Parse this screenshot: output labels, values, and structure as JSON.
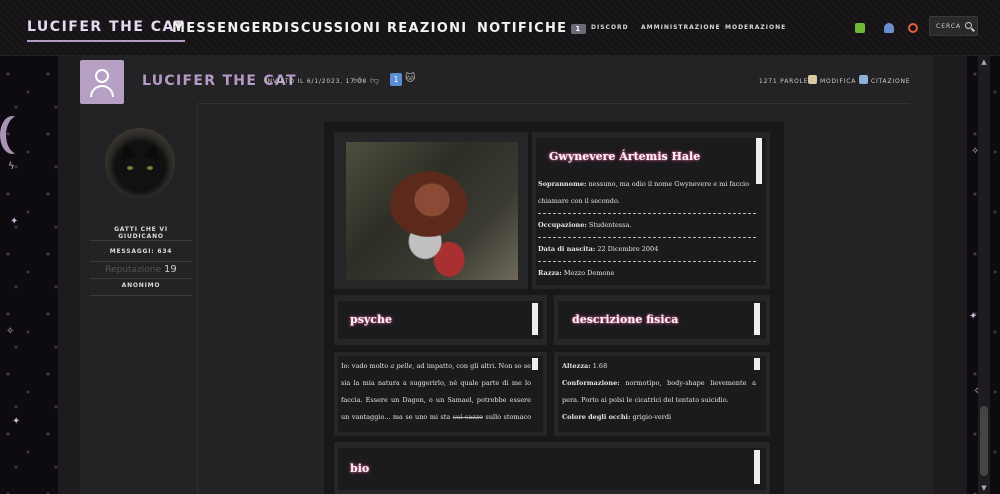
{
  "nav": {
    "brand": "LUCIFER THE CAT",
    "links": [
      "MESSENGER",
      "DISCUSSIONI",
      "REAZIONI",
      "NOTIFICHE"
    ],
    "notif_count": "1",
    "small_links": [
      "DISCORD",
      "AMMINISTRAZIONE",
      "MODERAZIONE"
    ],
    "search_placeholder": "CERCA"
  },
  "post": {
    "username": "LUCIFER THE CAT",
    "meta": "INVIATO IL 6/1/2023, 17:08",
    "reaction_count": "1",
    "word_count": "1271 PAROLE",
    "edit_label": "MODIFICA",
    "quote_label": "CITAZIONE"
  },
  "user": {
    "group": "GATTI CHE VI GIUDICANO",
    "messages": "MESSAGGI: 634",
    "rep_label": "Reputazione",
    "rep_value": "19",
    "anon": "ANONIMO"
  },
  "sheet": {
    "name": "Gwynevere Ártemis Hale",
    "nickname_label": "Soprannome:",
    "nickname_text": "nessuno, ma odio il nome Gwynevere e mi faccio chiamare con il secondo.",
    "job_label": "Occupazione:",
    "job_text": "Studentessa.",
    "birth_label": "Data di nascita:",
    "birth_text": "22 Dicembre 2004",
    "race_label": "Razza:",
    "race_text": "Mezzo Demone",
    "psyche_title": "psyche",
    "physical_title": "descrizione fisica",
    "psyche_p1": "Io: vado molto ",
    "psyche_italic": "a pelle",
    "psyche_p2": ", ad impatto, con gli altri. Non so se sia la mia natura a suggerirlo, né quale parte di me lo faccia. Essere un Dagon, o un Samael, potrebbe essere un vantaggio... ma se uno mi sta ",
    "psyche_strike": "sul cazzo",
    "psyche_p3": " sullo stomaco entro la",
    "height_label": "Altezza:",
    "height_text": "1.68",
    "build_label": "Conformazione:",
    "build_text": "normotipo, body-shape lievemente a pera. Porto ai polsi le cicatrici del tentato suicidio.",
    "eyes_label": "Colore degli occhi:",
    "eyes_text": "grigio-verdi",
    "bio_title": "bio"
  },
  "colors": {
    "accent": "#b59ac6",
    "glow": "#ff6fa8"
  }
}
